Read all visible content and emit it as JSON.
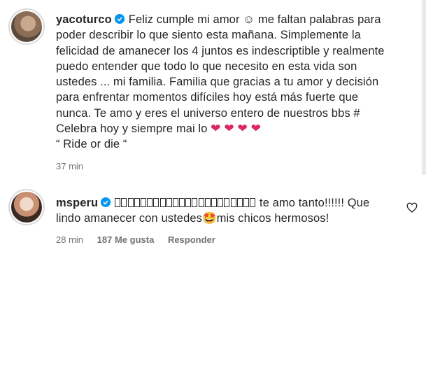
{
  "comments": [
    {
      "username": "yacoturco",
      "text_line1": "Feliz cumple mi amor ☺ me faltan palabras para",
      "text_line2": "poder describir lo que siento esta mañana. Simplemente la",
      "text_line3": "felicidad de amanecer los 4 juntos es indescriptible y realmente",
      "text_line4": "puedo entender que todo lo que necesito en esta vida son",
      "text_line5": "ustedes ... mi familia. Familia que gracias a tu amor y decisión",
      "text_line6": "para enfrentar momentos difíciles hoy está más fuerte que",
      "text_line7": "nunca. Te amo y eres el universo entero de nuestros bbs #",
      "text_line8": "Celebra hoy y siempre mai lo",
      "hearts": "❤ ❤ ❤ ❤",
      "text_line9": "“ Ride or die “",
      "time": "37 min"
    },
    {
      "username": "msperu",
      "box_count": 22,
      "text_line1": "te amo tanto!!!!!! Que",
      "text_line2a": "lindo amanecer con ustedes",
      "emoji": "🤩",
      "text_line2b": "mis chicos hermosos!",
      "time": "28 min",
      "likes": "187 Me gusta",
      "reply": "Responder"
    }
  ],
  "icons": {
    "verified": "verified-badge-icon",
    "like": "heart-outline-icon"
  },
  "colors": {
    "verified": "#0095f6",
    "meta_text": "#737373",
    "heart": "#e0245e"
  }
}
